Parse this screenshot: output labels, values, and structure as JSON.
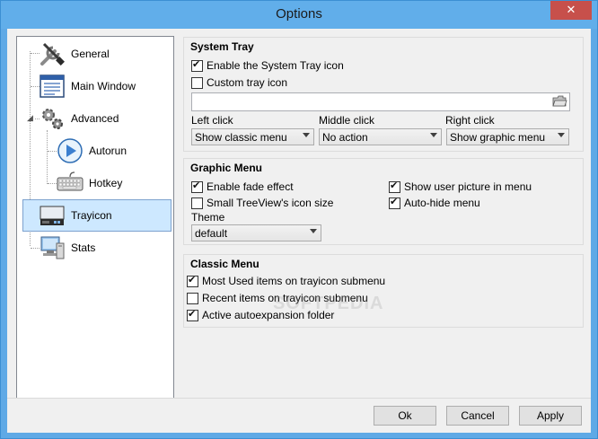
{
  "window": {
    "title": "Options",
    "close_glyph": "✕"
  },
  "tree": {
    "items": [
      {
        "label": "General",
        "icon": "tools-icon"
      },
      {
        "label": "Main Window",
        "icon": "window-icon"
      },
      {
        "label": "Advanced",
        "icon": "gears-icon"
      },
      {
        "label": "Autorun",
        "icon": "play-icon"
      },
      {
        "label": "Hotkey",
        "icon": "keyboard-icon"
      },
      {
        "label": "Trayicon",
        "icon": "tray-icon"
      },
      {
        "label": "Stats",
        "icon": "monitor-icon"
      }
    ],
    "selected": "Trayicon",
    "expander_glyph": "◢"
  },
  "system_tray": {
    "title": "System Tray",
    "enable_icon": {
      "label": "Enable the System Tray icon",
      "checked": true
    },
    "custom_icon": {
      "label": "Custom tray icon",
      "checked": false
    },
    "custom_icon_path": "",
    "left_click": {
      "label": "Left click",
      "value": "Show classic menu"
    },
    "middle_click": {
      "label": "Middle click",
      "value": "No action"
    },
    "right_click": {
      "label": "Right click",
      "value": "Show graphic menu"
    }
  },
  "graphic_menu": {
    "title": "Graphic Menu",
    "fade_effect": {
      "label": "Enable fade effect",
      "checked": true
    },
    "small_icons": {
      "label": "Small TreeView's icon size",
      "checked": false
    },
    "user_picture": {
      "label": "Show user picture in menu",
      "checked": true
    },
    "auto_hide": {
      "label": "Auto-hide menu",
      "checked": true
    },
    "theme": {
      "label": "Theme",
      "value": "default"
    }
  },
  "classic_menu": {
    "title": "Classic Menu",
    "most_used": {
      "label": "Most Used items on trayicon submenu",
      "checked": true
    },
    "recent": {
      "label": "Recent items on trayicon submenu",
      "checked": false
    },
    "autoexpansion": {
      "label": "Active autoexpansion folder",
      "checked": true
    }
  },
  "buttons": {
    "ok": "Ok",
    "cancel": "Cancel",
    "apply": "Apply"
  },
  "watermark": "SOFTPEDIA",
  "colors": {
    "titlebar": "#61aeea",
    "close": "#c7504b",
    "selection": "#cde8ff"
  }
}
